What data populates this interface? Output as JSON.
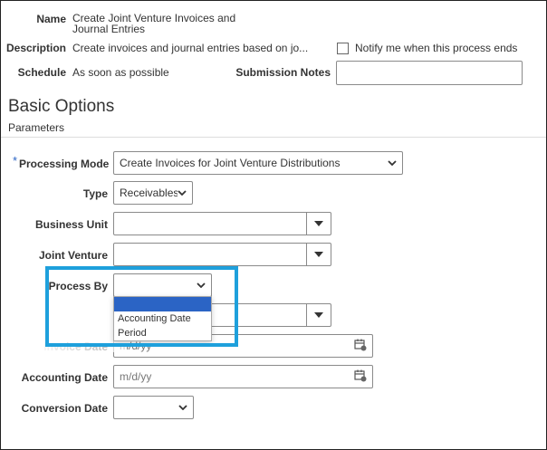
{
  "header": {
    "name_label": "Name",
    "name_value_line1": "Create Joint Venture Invoices and",
    "name_value_line2": "Journal Entries",
    "description_label": "Description",
    "description_value": "Create invoices and journal entries based on jo...",
    "notify_label": "Notify me when this process ends",
    "notify_checked": false,
    "schedule_label": "Schedule",
    "schedule_value": "As soon as possible",
    "submission_notes_label": "Submission Notes",
    "submission_notes_value": ""
  },
  "section": {
    "title": "Basic Options",
    "subtitle": "Parameters"
  },
  "form": {
    "required_marker": "*",
    "processing_mode_label": "Processing Mode",
    "processing_mode_value": "Create Invoices for Joint Venture Distributions",
    "type_label": "Type",
    "type_value": "Receivables",
    "business_unit_label": "Business Unit",
    "business_unit_value": "",
    "joint_venture_label": "Joint Venture",
    "joint_venture_value": "",
    "process_by_label": "Process By",
    "process_by_value": "",
    "process_by_options": [
      "",
      "Accounting Date",
      "Period"
    ],
    "invoice_date_label": "Invoice Date",
    "invoice_date_placeholder": "m/d/yy",
    "accounting_date_label": "Accounting Date",
    "accounting_date_placeholder": "m/d/yy",
    "conversion_date_label": "Conversion Date",
    "conversion_date_value": ""
  },
  "colors": {
    "highlight": "#1ea0dc",
    "dropdown_active": "#2b64c5",
    "required": "#2b64c5"
  }
}
